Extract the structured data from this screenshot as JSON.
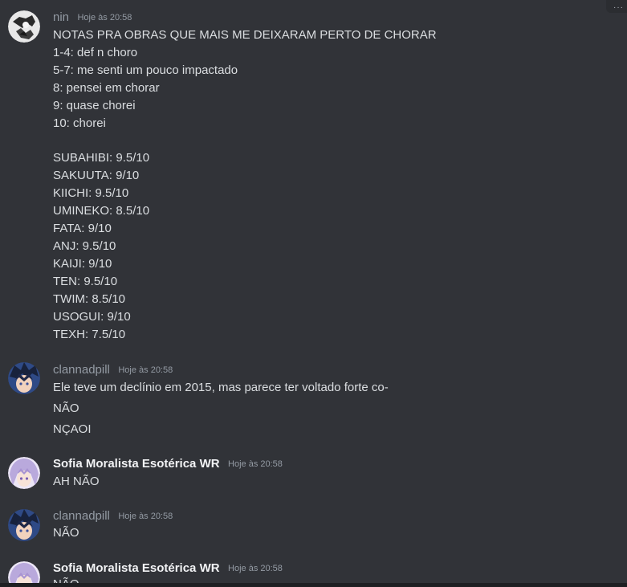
{
  "messages": [
    {
      "author": "nin",
      "time": "Hoje às 20:58",
      "lines": [
        "NOTAS PRA OBRAS QUE MAIS ME DEIXARAM PERTO DE CHORAR",
        "1-4: def n choro",
        "5-7: me senti um pouco impactado",
        "8: pensei em chorar",
        "9: quase chorei",
        "10: chorei",
        "",
        "SUBAHIBI: 9.5/10",
        "SAKUUTA: 9/10",
        "KIICHI: 9.5/10",
        "UMINEKO: 8.5/10",
        "FATA: 9/10",
        "ANJ: 9.5/10",
        "KAIJI: 9/10",
        "TEN: 9.5/10",
        "TWIM: 8.5/10",
        "USOGUI: 9/10",
        "TEXH: 7.5/10"
      ]
    },
    {
      "author": "clannadpill",
      "time": "Hoje às 20:58",
      "lines": [
        "Ele teve um declínio em 2015, mas parece ter voltado forte co-",
        "NÃO",
        "NÇAOI"
      ]
    },
    {
      "author": "Sofia Moralista Esotérica WR",
      "time": "Hoje às 20:58",
      "lines": [
        "AH NÃO"
      ]
    },
    {
      "author": "clannadpill",
      "time": "Hoje às 20:58",
      "lines": [
        "NÃO"
      ]
    },
    {
      "author": "Sofia Moralista Esotérica WR",
      "time": "Hoje às 20:58",
      "lines": [
        "NÃO"
      ]
    }
  ],
  "colors": {
    "background": "#313338",
    "text": "#dbdee1",
    "muted": "#949ba4"
  },
  "icons": {
    "corner": "more-options-icon"
  }
}
